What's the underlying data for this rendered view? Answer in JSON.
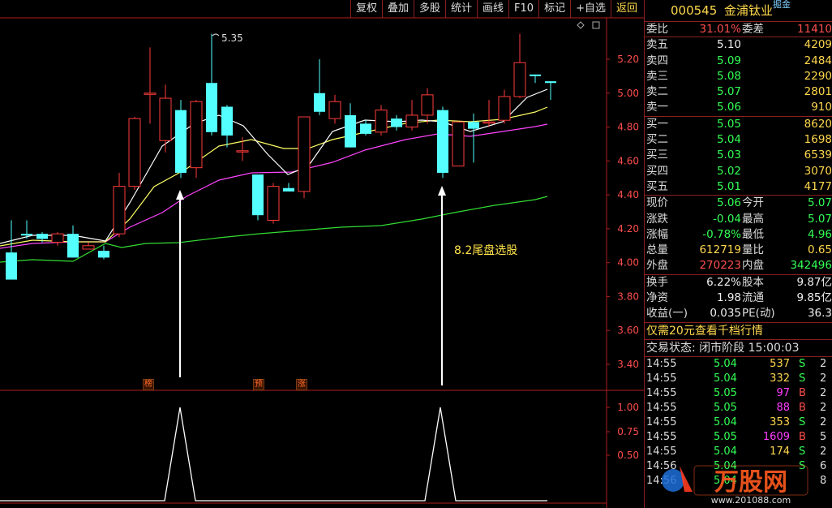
{
  "toolbar": [
    {
      "label": "复权",
      "name": "fuquan"
    },
    {
      "label": "叠加",
      "name": "diejia"
    },
    {
      "label": "多股",
      "name": "duogu"
    },
    {
      "label": "统计",
      "name": "tongji"
    },
    {
      "label": "画线",
      "name": "huaxian"
    },
    {
      "label": "F10",
      "name": "f10"
    },
    {
      "label": "标记",
      "name": "biaoji"
    },
    {
      "label": "+自选",
      "name": "zixuan"
    },
    {
      "label": "返回",
      "name": "fanhui"
    }
  ],
  "chart": {
    "peak_label": "5.35",
    "annotation": "8.2尾盘选股",
    "price_ticks": [
      "5.20",
      "5.00",
      "4.80",
      "4.60",
      "4.40",
      "4.20",
      "4.00",
      "3.80",
      "3.60",
      "3.40"
    ],
    "indicator_ticks": [
      "1.00",
      "0.75",
      "0.50"
    ],
    "markers": [
      {
        "label": "榜",
        "name": "marker-bang"
      },
      {
        "label": "预",
        "name": "marker-yu"
      },
      {
        "label": "涨",
        "name": "marker-zhang"
      }
    ],
    "colors": {
      "up": "#ff3b3b",
      "down": "#54ffff",
      "ma5": "#ffffff",
      "ma10": "#ffff66",
      "ma20": "#ff44ff",
      "ma60": "#33dd33",
      "axis": "#b01e1e"
    }
  },
  "quote": {
    "code": "000545",
    "name": "金浦钛业",
    "tag": "掘金",
    "weibi": {
      "label": "委比",
      "value": "31.01%",
      "label2": "委差",
      "value2": "11410"
    },
    "sell": [
      {
        "label": "卖五",
        "price": "5.10",
        "vol": "4209"
      },
      {
        "label": "卖四",
        "price": "5.09",
        "vol": "2484"
      },
      {
        "label": "卖三",
        "price": "5.08",
        "vol": "2290"
      },
      {
        "label": "卖二",
        "price": "5.07",
        "vol": "2801"
      },
      {
        "label": "卖一",
        "price": "5.06",
        "vol": "910"
      }
    ],
    "buy": [
      {
        "label": "买一",
        "price": "5.05",
        "vol": "8620"
      },
      {
        "label": "买二",
        "price": "5.04",
        "vol": "1698"
      },
      {
        "label": "买三",
        "price": "5.03",
        "vol": "6539"
      },
      {
        "label": "买四",
        "price": "5.02",
        "vol": "3070"
      },
      {
        "label": "买五",
        "price": "5.01",
        "vol": "4177"
      }
    ],
    "stats": [
      {
        "l1": "现价",
        "v1": "5.06",
        "l2": "今开",
        "v2": "5.07"
      },
      {
        "l1": "涨跌",
        "v1": "-0.04",
        "l2": "最高",
        "v2": "5.07"
      },
      {
        "l1": "涨幅",
        "v1": "-0.78%",
        "l2": "最低",
        "v2": "4.96"
      },
      {
        "l1": "总量",
        "v1": "612719",
        "l2": "量比",
        "v2": "0.65"
      },
      {
        "l1": "外盘",
        "v1": "270223",
        "l2": "内盘",
        "v2": "342496"
      }
    ],
    "fund": [
      {
        "l1": "换手",
        "v1": "6.22%",
        "l2": "股本",
        "v2": "9.87亿"
      },
      {
        "l1": "净资",
        "v1": "1.98",
        "l2": "流通",
        "v2": "9.85亿"
      },
      {
        "l1": "收益(一)",
        "v1": "0.035",
        "l2": "PE(动)",
        "v2": "36.3"
      }
    ],
    "promo": "仅需20元查看千档行情",
    "status": "交易状态: 闭市阶段 15:00:03",
    "ticks": [
      {
        "t": "14:55",
        "p": "5.04",
        "vol": "537",
        "bs": "S",
        "n": "2"
      },
      {
        "t": "14:55",
        "p": "5.04",
        "vol": "332",
        "bs": "S",
        "n": "2"
      },
      {
        "t": "14:55",
        "p": "5.05",
        "vol": "97",
        "bs": "B",
        "n": "2"
      },
      {
        "t": "14:55",
        "p": "5.05",
        "vol": "88",
        "bs": "B",
        "n": "2"
      },
      {
        "t": "14:55",
        "p": "5.04",
        "vol": "353",
        "bs": "S",
        "n": "2"
      },
      {
        "t": "14:55",
        "p": "5.05",
        "vol": "1609",
        "bs": "B",
        "n": "5"
      },
      {
        "t": "14:55",
        "p": "5.04",
        "vol": "174",
        "bs": "S",
        "n": "2"
      },
      {
        "t": "14:56",
        "p": "5.04",
        "vol": "",
        "bs": "S",
        "n": "6"
      },
      {
        "t": "14:56",
        "p": "5.04",
        "vol": "",
        "bs": "",
        "n": "8"
      }
    ],
    "watermark": {
      "title": "万股网",
      "url": "www.201088.com"
    }
  }
}
